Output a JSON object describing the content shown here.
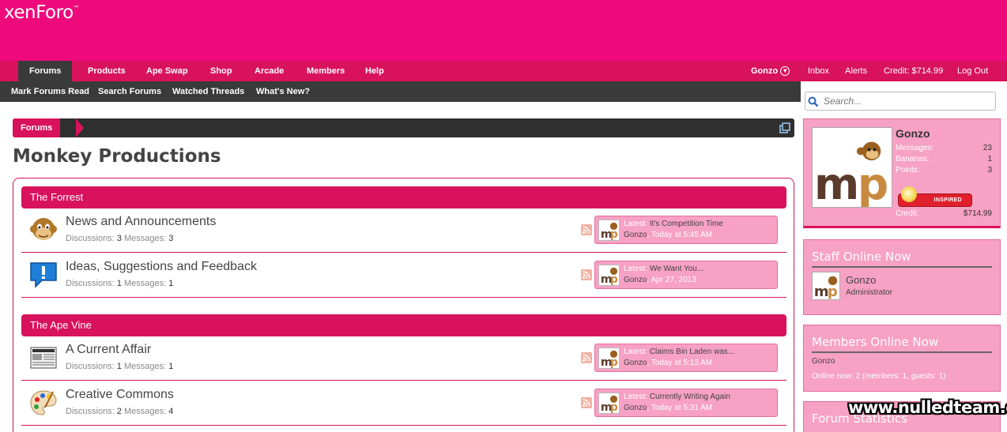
{
  "header": {
    "logo": "xenForo",
    "logo_mark": "™"
  },
  "nav": {
    "items": [
      "Forums",
      "Products",
      "Ape Swap",
      "Shop",
      "Arcade",
      "Members",
      "Help"
    ],
    "user": "Gonzo",
    "inbox": "Inbox",
    "alerts": "Alerts",
    "credit": "Credit: $714.99",
    "logout": "Log Out"
  },
  "subnav": {
    "items": [
      "Mark Forums Read",
      "Search Forums",
      "Watched Threads",
      "What's New?"
    ]
  },
  "search": {
    "placeholder": "Search..."
  },
  "breadcrumb": {
    "current": "Forums"
  },
  "page": {
    "title": "Monkey Productions"
  },
  "categories": [
    {
      "name": "The Forrest",
      "forums": [
        {
          "title": "News and Announcements",
          "icon": "monkey-face-icon",
          "discussions": "3",
          "messages": "3",
          "latest_label": "Latest:",
          "latest_title": "It's Competition Time",
          "latest_user": "Gonzo",
          "latest_time": "Today at 5:45 AM"
        },
        {
          "title": "Ideas, Suggestions and Feedback",
          "icon": "exclamation-bubble-icon",
          "discussions": "1",
          "messages": "1",
          "latest_label": "Latest:",
          "latest_title": "We Want You...",
          "latest_user": "Gonzo",
          "latest_time": "Apr 27, 2013"
        }
      ]
    },
    {
      "name": "The Ape Vine",
      "forums": [
        {
          "title": "A Current Affair",
          "icon": "newspaper-icon",
          "discussions": "1",
          "messages": "1",
          "latest_label": "Latest:",
          "latest_title": "Claims Bin Laden was...",
          "latest_user": "Gonzo",
          "latest_time": "Today at 5:13 AM"
        },
        {
          "title": "Creative Commons",
          "icon": "palette-icon",
          "discussions": "2",
          "messages": "4",
          "latest_label": "Latest:",
          "latest_title": "Currently Writing Again",
          "latest_user": "Gonzo",
          "latest_time": "Today at 5:31 AM"
        }
      ]
    }
  ],
  "labels": {
    "discussions": "Discussions:",
    "messages": "Messages:"
  },
  "profile": {
    "name": "Gonzo",
    "messages_label": "Messages:",
    "messages": "23",
    "bananas_label": "Bananas:",
    "bananas": "1",
    "points_label": "Points:",
    "points": "3",
    "rank": "INSPIRED",
    "credit_label": "Credit:",
    "credit": "$714.99"
  },
  "staff": {
    "title": "Staff Online Now",
    "name": "Gonzo",
    "role": "Administrator"
  },
  "members": {
    "title": "Members Online Now",
    "list": "Gonzo",
    "online_now": "Online now: 2 (members: 1, guests: 1)"
  },
  "forum_stats": {
    "title": "Forum Statistics"
  },
  "watermark": "www.nulledteam.com",
  "colors": {
    "header": "#ee0a7b",
    "nav": "#d8125c",
    "subnav": "#3a3a3a",
    "sidebar": "#f7a1c4"
  }
}
